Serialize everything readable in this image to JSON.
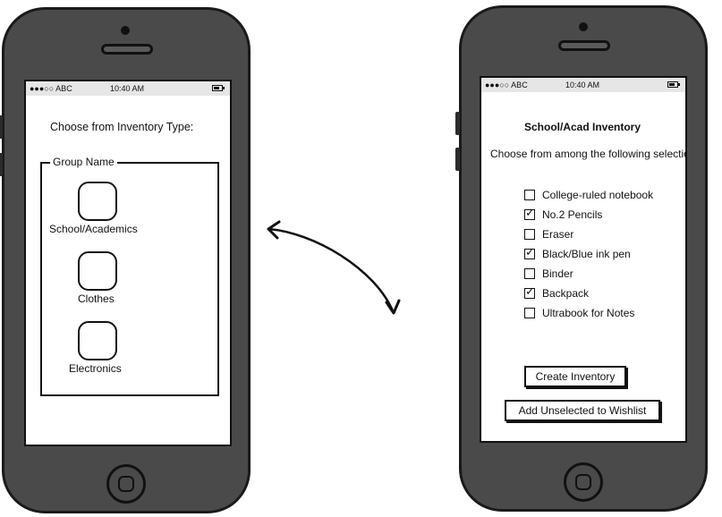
{
  "left_phone": {
    "status": {
      "signal": "●●●○○ ABC",
      "time": "10:40 AM"
    },
    "prompt": "Choose from Inventory Type:",
    "group_name": "Group Name",
    "categories": [
      {
        "label": "School/Academics"
      },
      {
        "label": "Clothes"
      },
      {
        "label": "Electronics"
      }
    ]
  },
  "right_phone": {
    "status": {
      "signal": "●●●○○ ABC",
      "time": "10:40 AM"
    },
    "title": "School/Acad Inventory",
    "subtitle": "Choose from among the following selections",
    "items": [
      {
        "label": "College-ruled notebook",
        "checked": false
      },
      {
        "label": "No.2 Pencils",
        "checked": true
      },
      {
        "label": "Eraser",
        "checked": false
      },
      {
        "label": "Black/Blue ink pen",
        "checked": true
      },
      {
        "label": "Binder",
        "checked": false
      },
      {
        "label": "Backpack",
        "checked": true
      },
      {
        "label": "Ultrabook for Notes",
        "checked": false
      }
    ],
    "create_button": "Create Inventory",
    "wishlist_button": "Add Unselected to Wishlist"
  }
}
